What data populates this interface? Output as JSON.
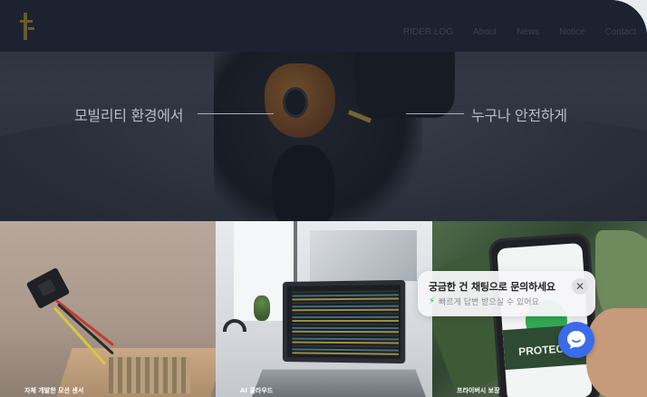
{
  "brand": {
    "logo_text": "",
    "logo_icon": "brand-logo-icon"
  },
  "nav": {
    "items": [
      "RIDER LOG",
      "About",
      "News",
      "Notice",
      "Contact"
    ]
  },
  "hero": {
    "tagline_left": "모빌리티 환경에서",
    "tagline_right": "누구나 안전하게"
  },
  "cards": [
    {
      "caption": "자체 개발한 모션 센서"
    },
    {
      "caption": "AI 클라우드"
    },
    {
      "caption": "프라이버시 보장"
    }
  ],
  "chat": {
    "title": "궁금한 건 채팅으로 문의하세요",
    "subtitle": "빠르게 답변 받으실 수 있어요",
    "close_icon": "close-icon",
    "launcher_icon": "chat-bubble-icon",
    "accent": "#3a6bea"
  },
  "colors": {
    "header_bg": "#1c2230",
    "bolt": "#27ae60"
  }
}
